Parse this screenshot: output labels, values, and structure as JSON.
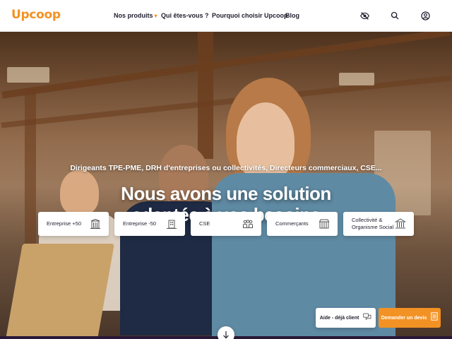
{
  "header": {
    "logo": "Upcoop",
    "nav": [
      {
        "label": "Nos produits",
        "has_dropdown": true
      },
      {
        "label": "Qui êtes-vous ?"
      },
      {
        "label": "Pourquoi choisir Upcoop"
      },
      {
        "label": "Blog"
      }
    ],
    "icons": [
      "eye-slash-icon",
      "search-icon",
      "user-icon"
    ]
  },
  "hero": {
    "subtitle": "Dirigeants TPE-PME, DRH d'entreprises ou collectivités, Directeurs commerciaux, CSE...",
    "title_line1": "Nous avons une solution",
    "title_line2": "adaptée à vos besoins"
  },
  "cards": [
    {
      "label": "Entreprise +50",
      "icon": "large-building-icon"
    },
    {
      "label": "Entreprise -50",
      "icon": "small-building-icon"
    },
    {
      "label": "CSE",
      "icon": "group-icon"
    },
    {
      "label": "Commerçants",
      "icon": "shop-icon"
    },
    {
      "label": "Collectivité & Organisme Social",
      "icon": "institution-icon"
    }
  ],
  "actions": {
    "help": "Aide - déjà client",
    "demo": "Demander un devis"
  },
  "colors": {
    "brand": "#f39224",
    "text_dark": "#1e1e2d",
    "white": "#ffffff"
  }
}
